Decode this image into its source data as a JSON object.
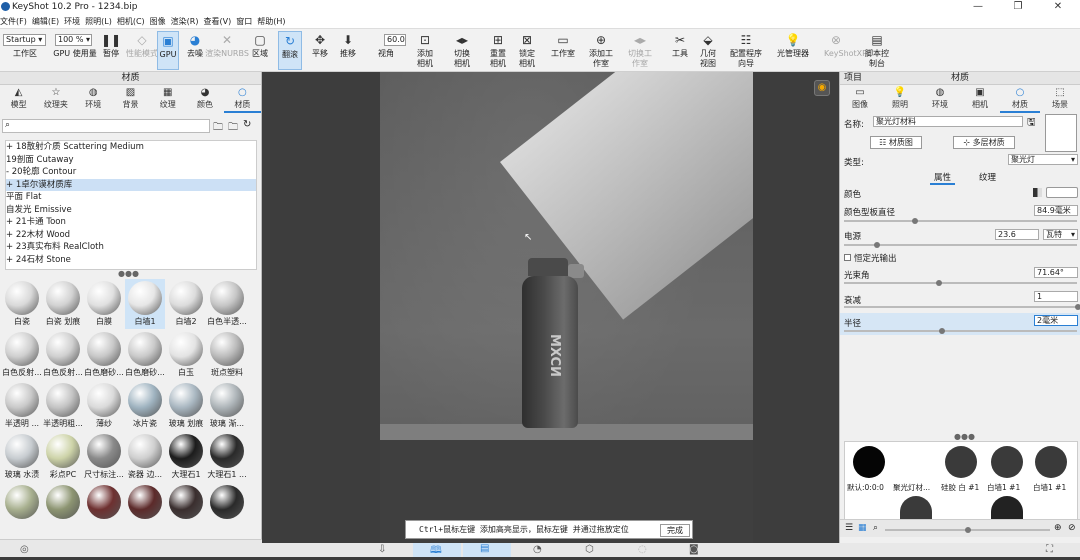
{
  "titlebar": {
    "title": "KeyShot 10.2 Pro - 1234.bip",
    "minimize": "—",
    "maximize": "❐",
    "close": "✕"
  },
  "menu": [
    "文件(F)",
    "编辑(E)",
    "环境",
    "照明(L)",
    "相机(C)",
    "图像",
    "渲染(R)",
    "查看(V)",
    "窗口",
    "帮助(H)"
  ],
  "toolbar": {
    "startup": "Startup ▾",
    "zoom": "100 % ▾",
    "fov": "60.0",
    "items": [
      "工作区",
      "GPU 使用量",
      "暂停",
      "性能模式",
      "GPU",
      "去噪",
      "渲染NURBS",
      "区域",
      "翻滚",
      "平移",
      "推移",
      "视角",
      "添加相机",
      "切换相机",
      "重置相机",
      "锁定相机",
      "工作室",
      "添加工作室",
      "切换工作室",
      "工具",
      "几何视图",
      "配置程序向导",
      "光管理器",
      "KeyShotXR",
      "脚本控制台"
    ]
  },
  "left_panel": {
    "header": "材质",
    "tabs": [
      "模型",
      "纹理夹",
      "环境",
      "背景",
      "纹理",
      "颜色",
      "材质"
    ],
    "tree": [
      "+ 18散射介质 Scattering Medium",
      "  19剖面 Cutaway",
      "- 20轮廓 Contour",
      "    + 1卓尔谟材质库",
      "      平面 Flat",
      "      自发光 Emissive",
      "+ 21卡通 Toon",
      "+ 22木材 Wood",
      "+ 23真实布料 RealCloth",
      "+ 24石材 Stone"
    ],
    "materials": [
      "白瓷",
      "白瓷 划痕",
      "白膜",
      "白墙1",
      "白墙2",
      "白色半透...",
      "白色反射...",
      "白色反射...",
      "白色磨砂...",
      "白色磨砂...",
      "白玉",
      "斑点塑料",
      "半透明 ...",
      "半透明粗...",
      "薄纱",
      "冰片瓷",
      "玻璃 划痕",
      "玻璃 渐...",
      "玻璃 水渍",
      "彩点PC",
      "尺寸标注...",
      "瓷器 边...",
      "大理石1",
      "大理石1 ...",
      "",
      "",
      "",
      "",
      "",
      ""
    ]
  },
  "viewport": {
    "bottle_text": "MXCИ",
    "hint": "Ctrl+鼠标左键 添加高亮显示，鼠标左键 并通过拖放定位",
    "done": "完成"
  },
  "right_panel": {
    "header_left": "项目",
    "header": "材质",
    "tabs": [
      "图像",
      "照明",
      "环境",
      "相机",
      "材质",
      "场景"
    ],
    "name_label": "名称:",
    "name_value": "聚光灯材料",
    "material_graph": "材质图",
    "multi_material": "多层材质",
    "type_label": "类型:",
    "type_value": "聚光灯",
    "sub_tabs": [
      "属性",
      "纹理"
    ],
    "color_label": "颜色",
    "diam_label": "颜色型板直径",
    "diam_value": "84.9毫米",
    "power_label": "电源",
    "power_value": "23.6",
    "power_unit": "瓦特",
    "constant_label": "恒定光输出",
    "beam_label": "光束角",
    "beam_value": "71.64°",
    "falloff_label": "衰减",
    "falloff_value": "1",
    "radius_label": "半径",
    "radius_value": "2毫米",
    "swatches": [
      "默认:0:0:0",
      "聚光灯材...",
      "硅胶 白 #1",
      "白墙1 #1",
      "白墙1 #1"
    ]
  },
  "colors": {
    "accent": "#2a7fd4"
  }
}
